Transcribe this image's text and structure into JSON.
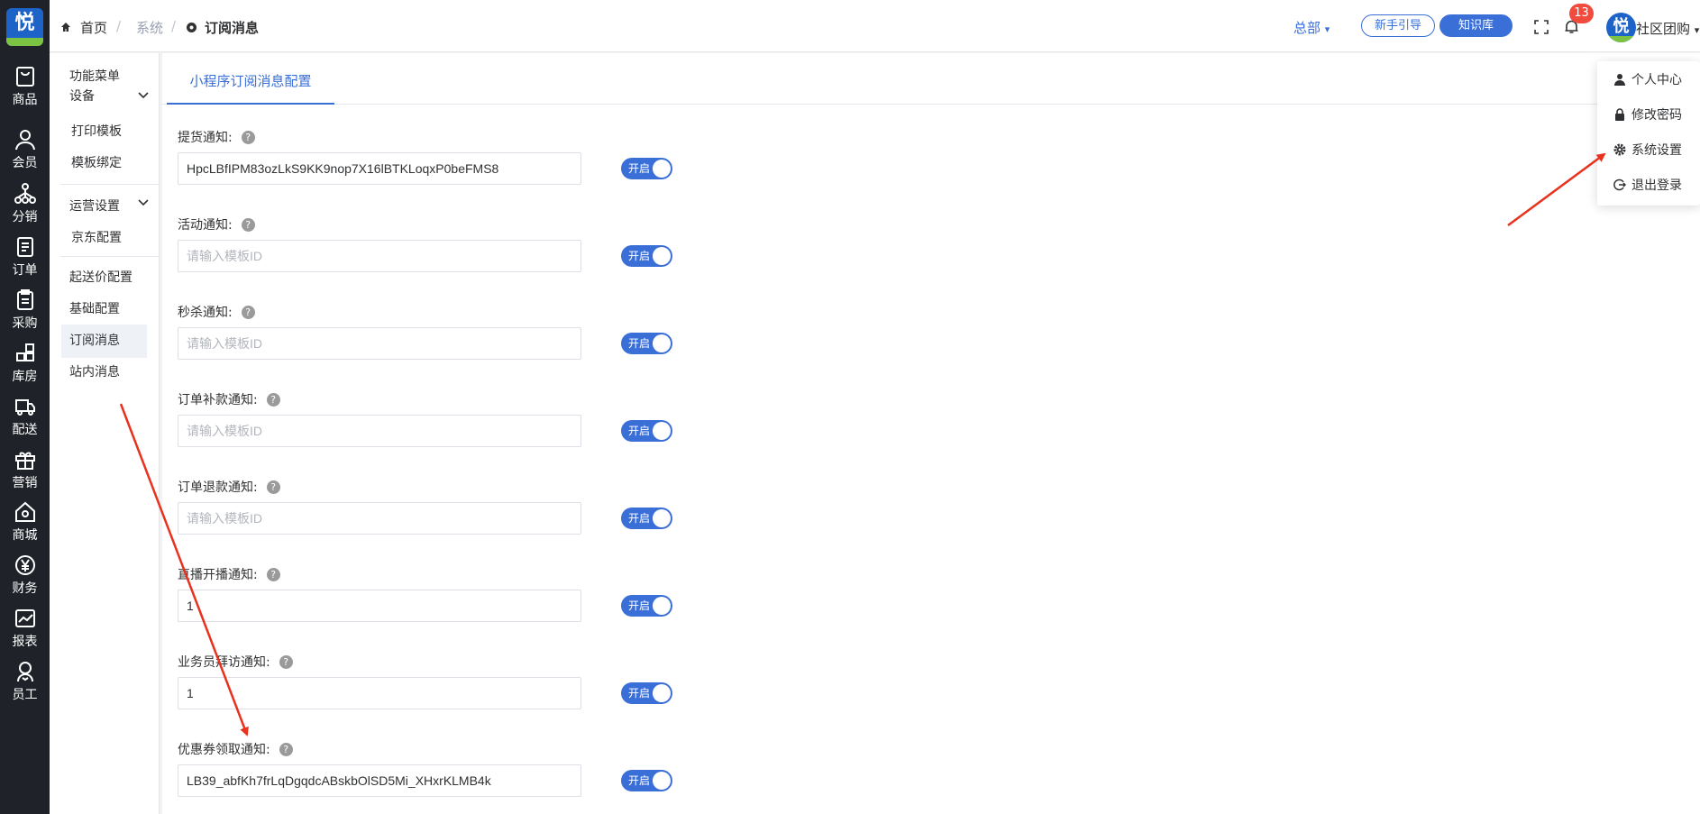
{
  "nav": {
    "logo_text": "悦",
    "items": [
      {
        "label": "商品",
        "icon": "bag-icon"
      },
      {
        "label": "会员",
        "icon": "user-icon"
      },
      {
        "label": "分销",
        "icon": "network-icon"
      },
      {
        "label": "订单",
        "icon": "document-icon"
      },
      {
        "label": "采购",
        "icon": "clipboard-icon"
      },
      {
        "label": "库房",
        "icon": "boxes-icon"
      },
      {
        "label": "配送",
        "icon": "truck-icon"
      },
      {
        "label": "营销",
        "icon": "gift-icon"
      },
      {
        "label": "商城",
        "icon": "home-icon"
      },
      {
        "label": "财务",
        "icon": "yen-icon"
      },
      {
        "label": "报表",
        "icon": "chart-icon"
      },
      {
        "label": "员工",
        "icon": "staff-icon"
      }
    ]
  },
  "breadcrumb": {
    "home": "首页",
    "parent": "系统",
    "current": "订阅消息",
    "sep": "/"
  },
  "topbar": {
    "scope": "总部",
    "guide_button": "新手引导",
    "kb_button": "知识库",
    "notification_count": "13",
    "avatar_text": "悦",
    "user_name": "社区团购"
  },
  "user_menu": {
    "items": [
      "个人中心",
      "修改密码",
      "系统设置",
      "退出登录"
    ]
  },
  "submenu": {
    "function_menu": "功能菜单",
    "device_group": "设备",
    "print_template": "打印模板",
    "template_binding": "模板绑定",
    "ops_group": "运营设置",
    "jd_config": "京东配置",
    "min_delivery": "起送价配置",
    "basic_config": "基础配置",
    "subscribe_msg": "订阅消息",
    "site_msg": "站内消息"
  },
  "tab": {
    "label": "小程序订阅消息配置"
  },
  "form": {
    "help_mark": "?",
    "switch_label": "开启",
    "placeholder": "请输入模板ID",
    "fields": [
      {
        "label": "提货通知:",
        "value": "HpcLBfIPM83ozLkS9KK9nop7X16lBTKLoqxP0beFMS8"
      },
      {
        "label": "活动通知:",
        "value": ""
      },
      {
        "label": "秒杀通知:",
        "value": ""
      },
      {
        "label": "订单补款通知:",
        "value": ""
      },
      {
        "label": "订单退款通知:",
        "value": ""
      },
      {
        "label": "直播开播通知:",
        "value": "1"
      },
      {
        "label": "业务员拜访通知:",
        "value": "1"
      },
      {
        "label": "优惠券领取通知:",
        "value": "LB39_abfKh7frLqDgqdcABskbOlSD5Mi_XHxrKLMB4k"
      }
    ]
  },
  "colors": {
    "accent": "#3a6fd8",
    "nav_bg": "#1f2329",
    "badge": "#f04b3c",
    "annotation": "#e8321e"
  }
}
